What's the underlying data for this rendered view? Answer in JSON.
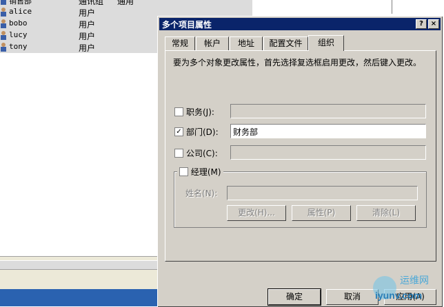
{
  "background_list": {
    "rows": [
      {
        "name": "销售部",
        "type": "通讯组",
        "desc": "通用"
      },
      {
        "name": "alice",
        "type": "用户",
        "desc": ""
      },
      {
        "name": "bobo",
        "type": "用户",
        "desc": ""
      },
      {
        "name": "lucy",
        "type": "用户",
        "desc": ""
      },
      {
        "name": "tony",
        "type": "用户",
        "desc": ""
      }
    ]
  },
  "dialog": {
    "title": "多个项目属性",
    "help_button": "?",
    "close_button": "×",
    "tabs": [
      {
        "label": "常规",
        "active": false
      },
      {
        "label": "帐户",
        "active": false
      },
      {
        "label": "地址",
        "active": false
      },
      {
        "label": "配置文件",
        "active": false
      },
      {
        "label": "组织",
        "active": true
      }
    ],
    "instruction": "要为多个对象更改属性，首先选择复选框启用更改，然后键入更改。",
    "fields": {
      "title": {
        "label": "职务(J):",
        "checked": false,
        "value": ""
      },
      "department": {
        "label": "部门(D):",
        "checked": true,
        "value": "财务部"
      },
      "company": {
        "label": "公司(C):",
        "checked": false,
        "value": ""
      }
    },
    "manager": {
      "label": "经理(M)",
      "checked": false,
      "name_label": "姓名(N):",
      "name_value": "",
      "buttons": {
        "change": "更改(H)...",
        "properties": "属性(P)",
        "clear": "清除(L)"
      }
    },
    "footer": {
      "ok": "确定",
      "cancel": "取消",
      "apply": "应用(A)"
    }
  },
  "watermark": {
    "line1": "运维网",
    "line2": "iyunv.com"
  },
  "colors": {
    "titlebar": "#0a246a",
    "dialog_bg": "#d4d0c8",
    "taskbar": "#2a62b0"
  }
}
